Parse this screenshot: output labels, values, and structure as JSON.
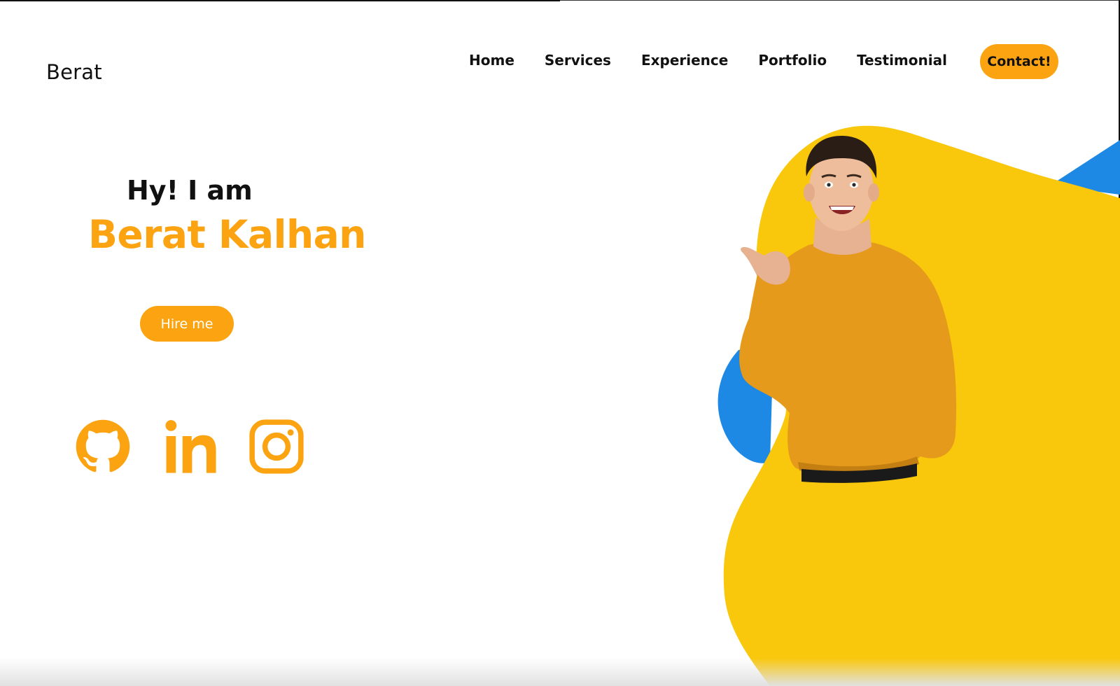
{
  "header": {
    "logo": "Berat",
    "nav": [
      "Home",
      "Services",
      "Experience",
      "Portfolio",
      "Testimonial"
    ],
    "contact_label": "Contact!"
  },
  "hero": {
    "greeting": "Hy! I am",
    "name": "Berat Kalhan",
    "hire_label": "Hire me"
  },
  "social": {
    "icons": [
      "github-icon",
      "linkedin-icon",
      "instagram-icon"
    ]
  },
  "colors": {
    "accent": "#fca311",
    "text": "#111111",
    "blob_yellow": "#f9c70c",
    "blob_blue": "#1e88e5",
    "sweater": "#e59a1c"
  }
}
